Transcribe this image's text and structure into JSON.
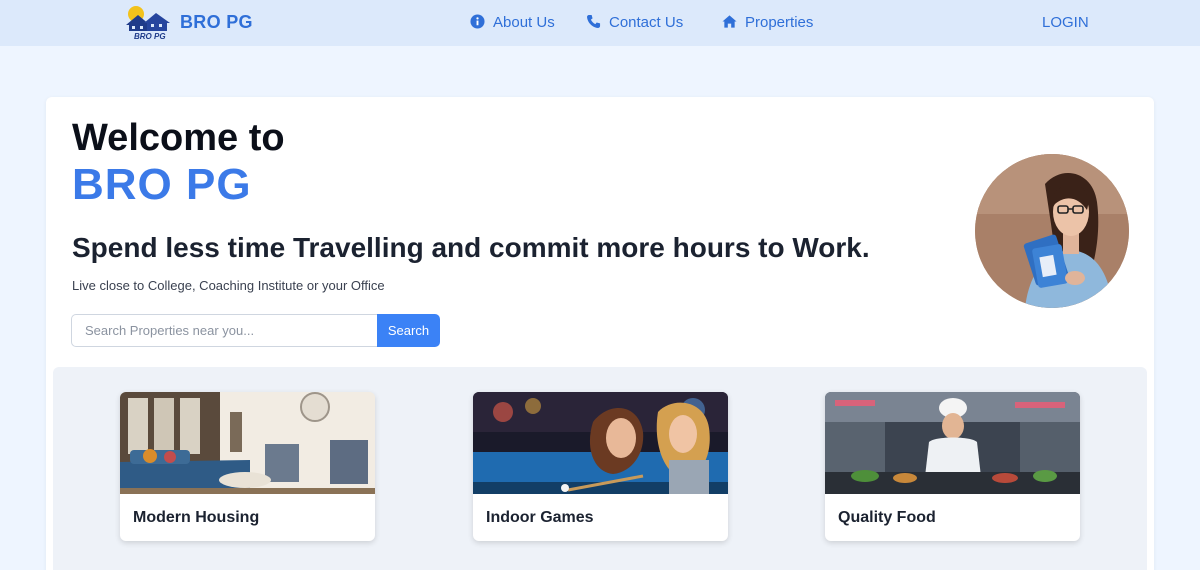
{
  "navbar": {
    "logo_text": "BRO PG",
    "brand_name": "BRO PG",
    "links": [
      {
        "label": "About Us",
        "icon": "info-circle-icon"
      },
      {
        "label": "Contact Us",
        "icon": "phone-icon"
      },
      {
        "label": "Properties",
        "icon": "home-icon"
      }
    ],
    "login_label": "LOGIN"
  },
  "hero": {
    "welcome": "Welcome to",
    "brand": "BRO PG",
    "tagline": "Spend less time Travelling and commit more hours to Work.",
    "subline": "Live close to College, Coaching Institute or your Office",
    "search": {
      "placeholder": "Search Properties near you...",
      "value": "",
      "button_label": "Search"
    }
  },
  "features": [
    {
      "title": "Modern Housing"
    },
    {
      "title": "Indoor Games"
    },
    {
      "title": "Quality Food"
    }
  ],
  "colors": {
    "accent": "#3b82f6",
    "brand_text": "#2f6fd8",
    "navbar_bg": "#dce9fb",
    "page_bg": "#eef5ff"
  }
}
